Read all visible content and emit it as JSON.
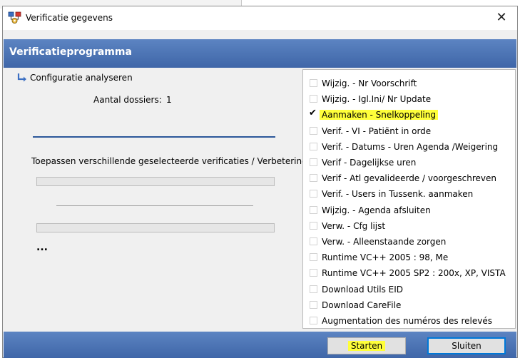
{
  "dialog": {
    "title": "Verificatie gegevens",
    "close_symbol": "✕"
  },
  "banner": {
    "title": "Verificatieprogramma"
  },
  "left": {
    "analyze_label": "Configuratie analyseren",
    "dossiers_label": "Aantal dossiers:",
    "dossiers_value": "1",
    "apply_label": "Toepassen verschillende geselecteerde verificaties / Verbetering",
    "progress_1": 0,
    "progress_2": 0,
    "ellipsis": "..."
  },
  "checklist": {
    "items": [
      {
        "label": "Wijzig. - Nr Voorschrift",
        "checked": false
      },
      {
        "label": "Wijzig. - Igl.Ini/ Nr Update",
        "checked": false
      },
      {
        "label": "Aanmaken - Snelkoppeling",
        "checked": true,
        "highlighted": true
      },
      {
        "label": "Verif. - VI - Patiënt in orde",
        "checked": false
      },
      {
        "label": "Verif. - Datums - Uren Agenda /Weigering",
        "checked": false
      },
      {
        "label": "Verif - Dagelijkse uren",
        "checked": false
      },
      {
        "label": "Verif - Atl gevalideerde / voorgeschreven",
        "checked": false
      },
      {
        "label": "Verif. - Users in Tussenk. aanmaken",
        "checked": false
      },
      {
        "label": "Wijzig. - Agenda afsluiten",
        "checked": false
      },
      {
        "label": "Verw. - Cfg lijst",
        "checked": false
      },
      {
        "label": "Verw. - Alleenstaande zorgen",
        "checked": false
      },
      {
        "label": "Runtime VC++ 2005 : 98, Me",
        "checked": false
      },
      {
        "label": "Runtime VC++ 2005 SP2 : 200x, XP, VISTA",
        "checked": false
      },
      {
        "label": "Download Utils EID",
        "checked": false
      },
      {
        "label": "Download CareFile",
        "checked": false
      },
      {
        "label": "Augmentation des numéros des relevés",
        "checked": false
      }
    ]
  },
  "footer": {
    "start_label": "Starten",
    "close_label": "Sluiten"
  },
  "colors": {
    "banner": "#4a72b4",
    "highlight": "#ffff3a",
    "divider_blue": "#2b579a"
  },
  "icons": {
    "title": "app-gear-network-icon",
    "analyze": "arrow-down-right-icon"
  }
}
